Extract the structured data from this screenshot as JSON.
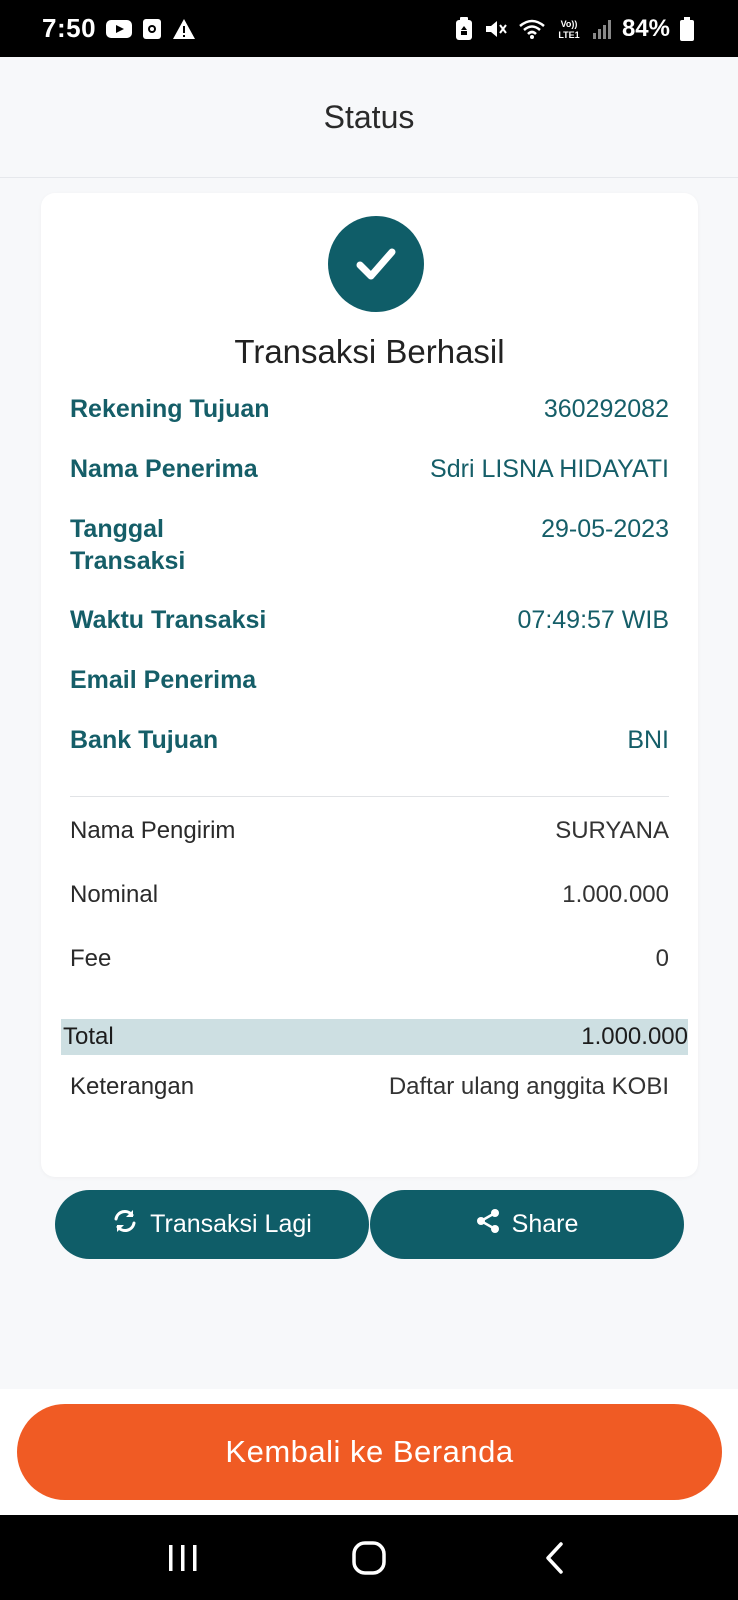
{
  "status_bar": {
    "time": "7:50",
    "battery": "84%",
    "left_icons": [
      "youtube-icon",
      "app-notification-icon",
      "warning-icon"
    ],
    "right_icons": [
      "recycle-icon",
      "mute-icon",
      "wifi-icon",
      "volte-icon",
      "signal-icon",
      "battery-icon"
    ]
  },
  "header": {
    "title": "Status"
  },
  "result": {
    "title": "Transaksi Berhasil",
    "check_icon": "check-icon",
    "accent_color": "#0f5d68"
  },
  "details": {
    "rekening_tujuan": {
      "label": "Rekening Tujuan",
      "value": "360292082"
    },
    "nama_penerima": {
      "label": "Nama Penerima",
      "value": "Sdri LISNA HIDAYATI"
    },
    "tanggal_transaksi": {
      "label_line1": "Tanggal",
      "label_line2": "Transaksi",
      "value": "29-05-2023"
    },
    "waktu_transaksi": {
      "label": "Waktu Transaksi",
      "value": "07:49:57 WIB"
    },
    "email_penerima": {
      "label": "Email Penerima",
      "value": ""
    },
    "bank_tujuan": {
      "label": "Bank Tujuan",
      "value": "BNI"
    }
  },
  "summary": {
    "nama_pengirim": {
      "label": "Nama Pengirim",
      "value": "SURYANA"
    },
    "nominal": {
      "label": "Nominal",
      "value": "1.000.000"
    },
    "fee": {
      "label": "Fee",
      "value": "0"
    },
    "total": {
      "label": "Total",
      "value": "1.000.000"
    },
    "keterangan": {
      "label": "Keterangan",
      "value": "Daftar ulang anggita KOBI"
    }
  },
  "actions": {
    "again_label": "Transaksi Lagi",
    "again_icon": "refresh-icon",
    "share_label": "Share",
    "share_icon": "share-icon"
  },
  "footer": {
    "home_label": "Kembali ke Beranda",
    "home_color": "#f05b24"
  },
  "nav": [
    "recent-apps-icon",
    "home-icon",
    "back-icon"
  ]
}
